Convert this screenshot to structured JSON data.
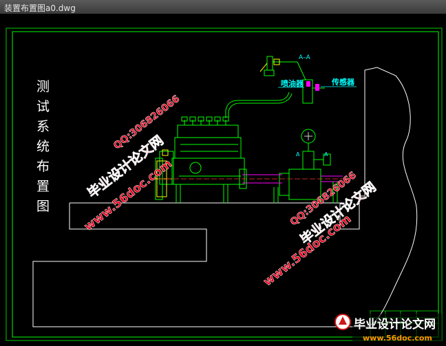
{
  "window": {
    "title": "装置布置图a0.dwg"
  },
  "drawing": {
    "side_title": [
      "测",
      "试",
      "系",
      "统",
      "布",
      "置",
      "图"
    ],
    "section_label": "A–A",
    "label_injector": "喷油器",
    "label_sensor": "传感器",
    "marker_a_left": "A",
    "marker_a_right": "A"
  },
  "watermarks": {
    "site": "www.56doc.com",
    "qq": "QQ:306826066",
    "brand": "毕业设计论文网"
  },
  "footer_logo": {
    "brand": "毕业设计论文网",
    "url": "www.56doc.com"
  },
  "colors": {
    "frame": "#00ff00",
    "outline": "#ffffff",
    "label_cyan": "#00ffff",
    "magenta": "#ff00ff",
    "watermark_red": "#e8001c",
    "watermark_outline": "#ffffff"
  }
}
